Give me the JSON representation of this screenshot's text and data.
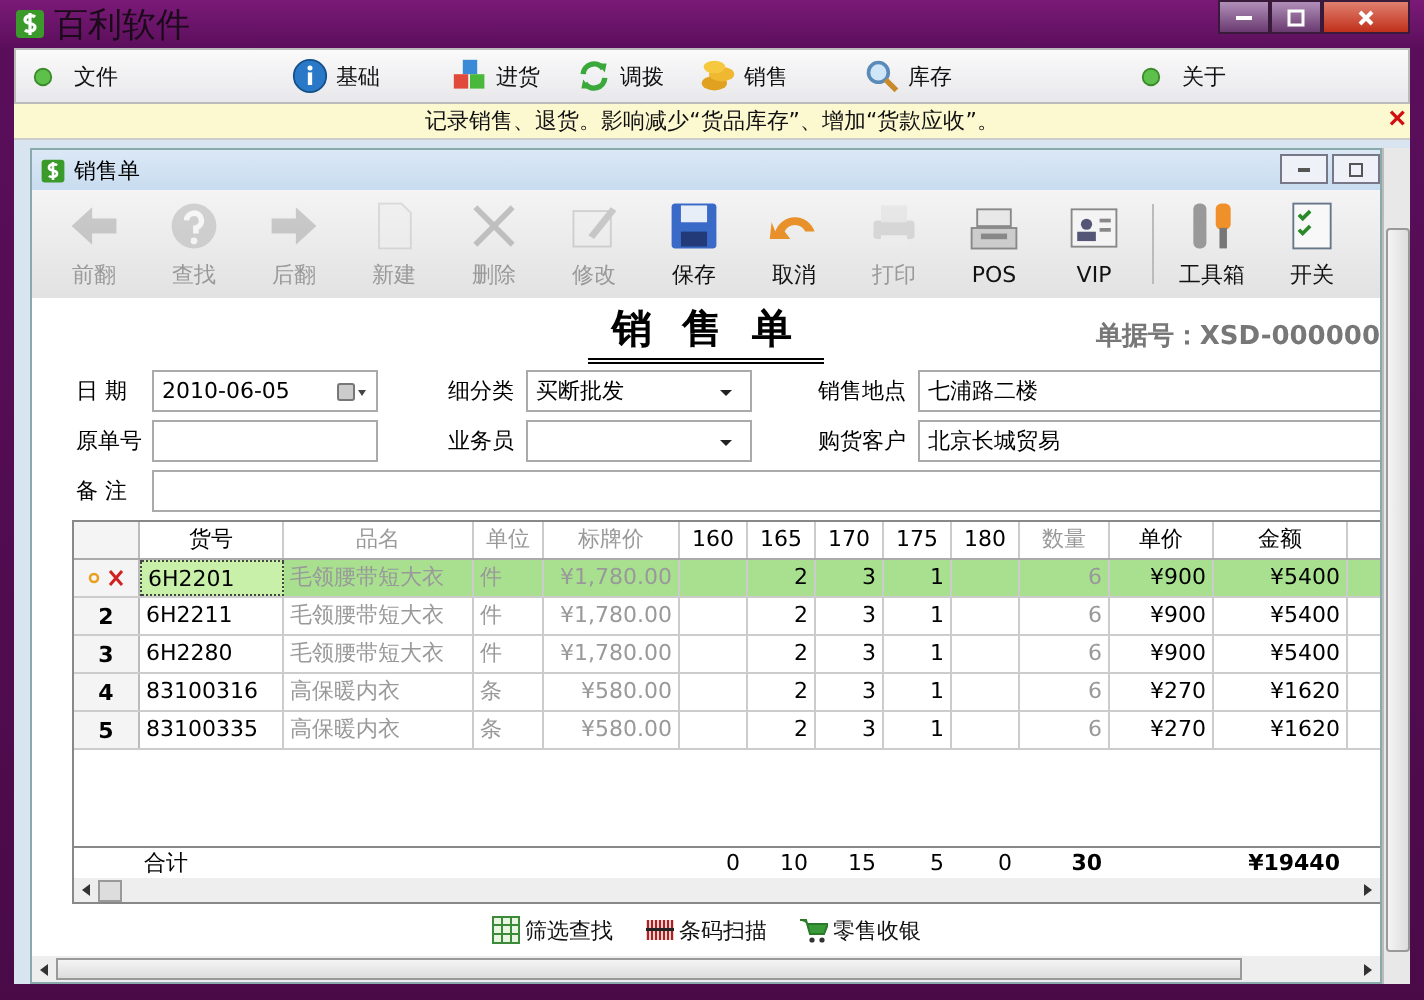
{
  "window": {
    "title": "百利软件"
  },
  "menu": [
    {
      "label": "文件"
    },
    {
      "label": "基础"
    },
    {
      "label": "进货"
    },
    {
      "label": "调拨"
    },
    {
      "label": "销售"
    },
    {
      "label": "库存"
    },
    {
      "label": "关于"
    }
  ],
  "info_bar": {
    "text": "记录销售、退货。影响减少“货品库存”、增加“货款应收”。",
    "close": "×"
  },
  "document_window": {
    "title": "销售单"
  },
  "toolbar": [
    {
      "label": "前翻",
      "disabled": true
    },
    {
      "label": "查找",
      "disabled": true
    },
    {
      "label": "后翻",
      "disabled": true
    },
    {
      "label": "新建",
      "disabled": true
    },
    {
      "label": "删除",
      "disabled": true
    },
    {
      "label": "修改",
      "disabled": true
    },
    {
      "label": "保存",
      "disabled": false
    },
    {
      "label": "取消",
      "disabled": false
    },
    {
      "label": "打印",
      "disabled": true
    },
    {
      "label": "POS",
      "disabled": false
    },
    {
      "label": "VIP",
      "disabled": false
    },
    {
      "label": "工具箱",
      "disabled": false
    },
    {
      "label": "开关",
      "disabled": false
    }
  ],
  "form": {
    "title": "销 售 单",
    "doc_number": "单据号：XSD-000000",
    "fields": [
      {
        "label": "日 期",
        "value": "2010-06-05",
        "kind": "date"
      },
      {
        "label": "细分类",
        "value": "买断批发",
        "kind": "select"
      },
      {
        "label": "销售地点",
        "value": "七浦路二楼",
        "kind": "text"
      },
      {
        "label": "原单号",
        "kind": "text"
      },
      {
        "label": "业务员",
        "kind": "select"
      },
      {
        "label": "购货客户",
        "value": "北京长城贸易",
        "kind": "text"
      },
      {
        "label": "备 注",
        "kind": "wide"
      }
    ]
  },
  "table": {
    "columns": [
      {
        "label": "货号",
        "dim": false
      },
      {
        "label": "品名",
        "dim": true
      },
      {
        "label": "单位",
        "dim": true
      },
      {
        "label": "标牌价",
        "dim": true
      },
      {
        "label": "160",
        "dim": false
      },
      {
        "label": "165",
        "dim": false
      },
      {
        "label": "170",
        "dim": false
      },
      {
        "label": "175",
        "dim": false
      },
      {
        "label": "180",
        "dim": false
      },
      {
        "label": "数量",
        "dim": true
      },
      {
        "label": "单价",
        "dim": false
      },
      {
        "label": "金额",
        "dim": false
      }
    ],
    "rows": [
      {
        "selected": true,
        "cells": [
          "6H2201",
          "毛领腰带短大衣",
          "件",
          "¥1,780.00",
          "",
          "2",
          "3",
          "1",
          "",
          "6",
          "¥900",
          "¥5400"
        ]
      },
      {
        "number": "2",
        "selected": false,
        "cells": [
          "6H2211",
          "毛领腰带短大衣",
          "件",
          "¥1,780.00",
          "",
          "2",
          "3",
          "1",
          "",
          "6",
          "¥900",
          "¥5400"
        ]
      },
      {
        "number": "3",
        "selected": false,
        "cells": [
          "6H2280",
          "毛领腰带短大衣",
          "件",
          "¥1,780.00",
          "",
          "2",
          "3",
          "1",
          "",
          "6",
          "¥900",
          "¥5400"
        ]
      },
      {
        "number": "4",
        "selected": false,
        "cells": [
          "83100316",
          "高保暖内衣",
          "条",
          "¥580.00",
          "",
          "2",
          "3",
          "1",
          "",
          "6",
          "¥270",
          "¥1620"
        ]
      },
      {
        "number": "5",
        "selected": false,
        "cells": [
          "83100335",
          "高保暖内衣",
          "条",
          "¥580.00",
          "",
          "2",
          "3",
          "1",
          "",
          "6",
          "¥270",
          "¥1620"
        ]
      }
    ],
    "totals": {
      "label": "合计",
      "cells": [
        "",
        "",
        "",
        "",
        "0",
        "10",
        "15",
        "5",
        "0",
        "30",
        "",
        "¥19440"
      ]
    }
  },
  "bottom_buttons": [
    {
      "label": "筛选查找"
    },
    {
      "label": "条码扫描"
    },
    {
      "label": "零售收银"
    }
  ]
}
